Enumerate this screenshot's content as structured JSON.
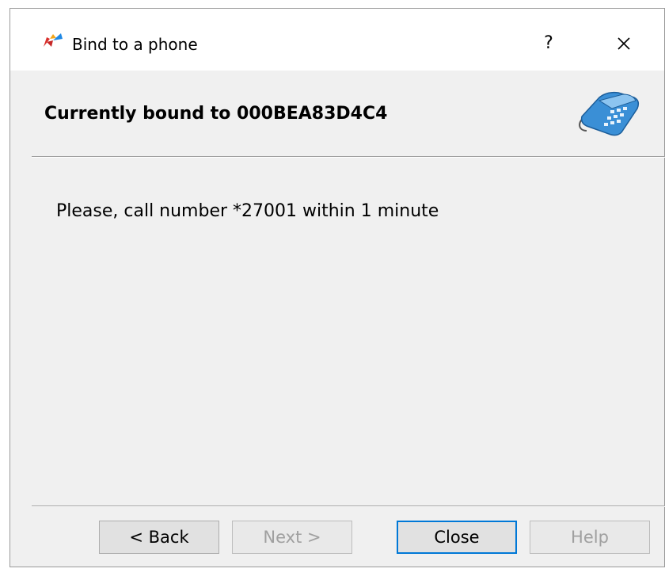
{
  "window": {
    "title": "Bind to a phone",
    "help_label": "?"
  },
  "header": {
    "title": "Currently bound to 000BEA83D4C4"
  },
  "content": {
    "message": "Please, call number *27001 within 1 minute"
  },
  "buttons": {
    "back": "< Back",
    "next": "Next >",
    "close": "Close",
    "help": "Help"
  },
  "icons": {
    "app": "app-logo-icon",
    "phone": "telephone-icon",
    "close": "close-icon"
  },
  "colors": {
    "default_button_border": "#0078d7",
    "disabled_text": "#a0a0a0",
    "dialog_background": "#f0f0f0"
  }
}
